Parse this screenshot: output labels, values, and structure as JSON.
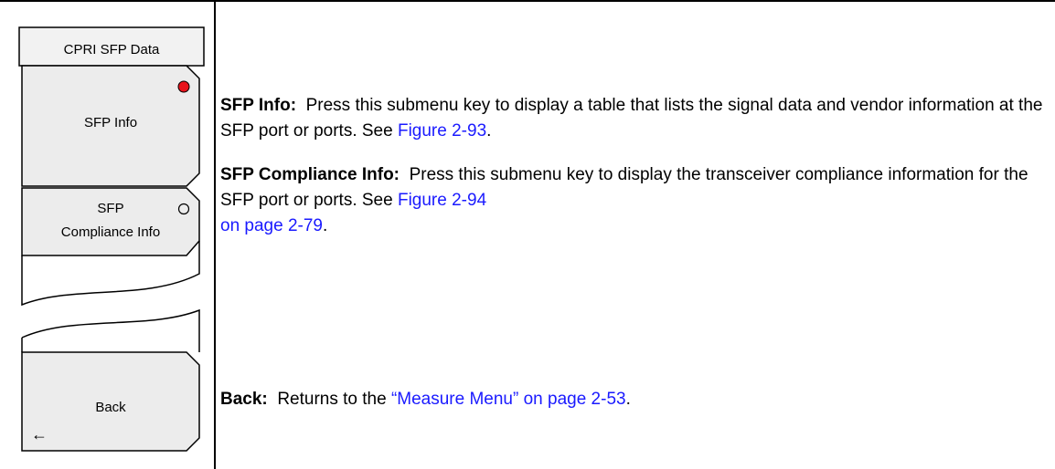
{
  "menu": {
    "title": "CPRI SFP Data",
    "keys": [
      {
        "label": "SFP Info",
        "indicator": "selected"
      },
      {
        "label_line1": "SFP",
        "label_line2": "Compliance Info",
        "indicator": "unselected"
      },
      {
        "label": "Back",
        "arrow": "←"
      }
    ]
  },
  "descriptions": [
    {
      "term": "SFP Info:",
      "text": "Press this submenu key to display a table that lists the signal data and vendor information at the SFP port or ports. See ",
      "link": "Figure 2-93",
      "after": "."
    },
    {
      "term": "SFP Compliance Info:",
      "text": "Press this submenu key to display the transceiver compliance information for the SFP port or ports. See ",
      "link_line1": "Figure 2-94",
      "link_line2": "on page 2-79",
      "after": "."
    },
    {
      "term": "Back:",
      "text": "Returns to the ",
      "link": "“Measure Menu” on page 2-53",
      "after": "."
    }
  ],
  "colors": {
    "indicator_selected": "#e8141c",
    "link": "#1a1aff"
  }
}
